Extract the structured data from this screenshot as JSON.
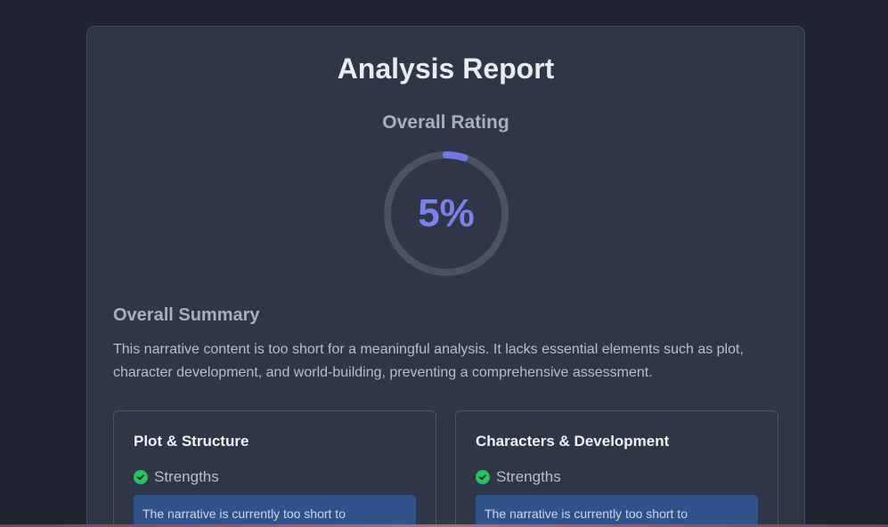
{
  "report": {
    "title": "Analysis Report",
    "rating_label": "Overall Rating",
    "rating_value": "5%",
    "rating_fraction": 0.05,
    "accent_color": "#7a82e8"
  },
  "summary": {
    "heading": "Overall Summary",
    "text": "This narrative content is too short for a meaningful analysis. It lacks essential elements such as plot, character development, and world-building, preventing a comprehensive assessment."
  },
  "sections": [
    {
      "title": "Plot & Structure",
      "strengths_label": "Strengths",
      "strengths_icon": "check-circle-icon",
      "note": "The narrative is currently too short to"
    },
    {
      "title": "Characters & Development",
      "strengths_label": "Strengths",
      "strengths_icon": "check-circle-icon",
      "note": "The narrative is currently too short to"
    }
  ]
}
